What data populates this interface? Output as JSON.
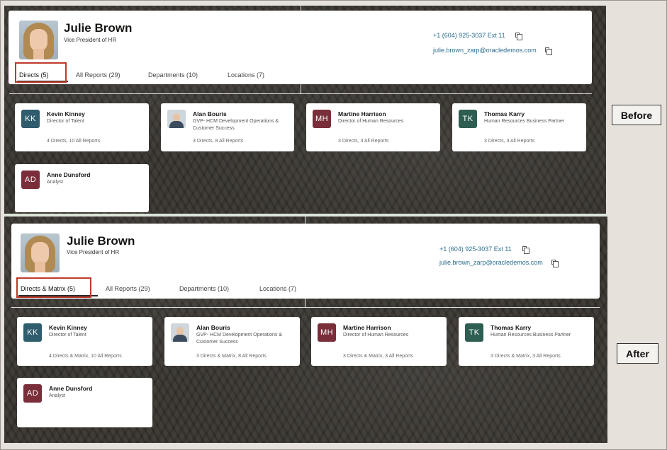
{
  "before": {
    "label": "Before",
    "profile": {
      "name": "Julie Brown",
      "title": "Vice President of HR",
      "phone": "+1 (604) 925-3037 Ext 11",
      "email": "julie.brown_zarp@oracledemos.com"
    },
    "tabs": [
      "Directs (5)",
      "All Reports (29)",
      "Departments (10)",
      "Locations (7)"
    ],
    "cards": [
      {
        "initials": "KK",
        "color": "#2f5d6e",
        "name": "Kevin Kinney",
        "title": "Director of Talent",
        "stats": "4 Directs, 10 All Reports"
      },
      {
        "initials": "",
        "color": "",
        "name": "Alan Bouris",
        "title": "GVP- HCM Development Operations & Customer Success",
        "stats": "3 Directs, 8 All Reports"
      },
      {
        "initials": "MH",
        "color": "#7a2e3a",
        "name": "Martine Harrison",
        "title": "Director of Human Resources",
        "stats": "3 Directs, 3 All Reports"
      },
      {
        "initials": "TK",
        "color": "#2e5e52",
        "name": "Thomas Karry",
        "title": "Human Resources Business Partner",
        "stats": "3 Directs, 3 All Reports"
      },
      {
        "initials": "AD",
        "color": "#7a2e3a",
        "name": "Anne Dunsford",
        "title": "Analyst",
        "stats": ""
      }
    ]
  },
  "after": {
    "label": "After",
    "profile": {
      "name": "Julie Brown",
      "title": "Vice President of HR",
      "phone": "+1 (604) 925-3037 Ext 11",
      "email": "julie.brown_zarp@oracledemos.com"
    },
    "tabs": [
      "Directs & Matrix (5)",
      "All Reports (29)",
      "Departments (10)",
      "Locations (7)"
    ],
    "cards": [
      {
        "initials": "KK",
        "color": "#2f5d6e",
        "name": "Kevin Kinney",
        "title": "Director of Talent",
        "stats": "4 Directs & Matrix, 10 All Reports"
      },
      {
        "initials": "",
        "color": "",
        "name": "Alan Bouris",
        "title": "GVP- HCM Development Operations & Customer Success",
        "stats": "3 Directs & Matrix, 8 All Reports"
      },
      {
        "initials": "MH",
        "color": "#7a2e3a",
        "name": "Martine Harrison",
        "title": "Director of Human Resources",
        "stats": "3 Directs & Matrix, 3 All Reports"
      },
      {
        "initials": "TK",
        "color": "#2e5e52",
        "name": "Thomas Karry",
        "title": "Human Resources Business Partner",
        "stats": "3 Directs & Matrix, 3 All Reports"
      },
      {
        "initials": "AD",
        "color": "#7a2e3a",
        "name": "Anne Dunsford",
        "title": "Analyst",
        "stats": ""
      }
    ]
  },
  "colors": {
    "highlight": "#c0392b",
    "link": "#2c6e8f"
  }
}
